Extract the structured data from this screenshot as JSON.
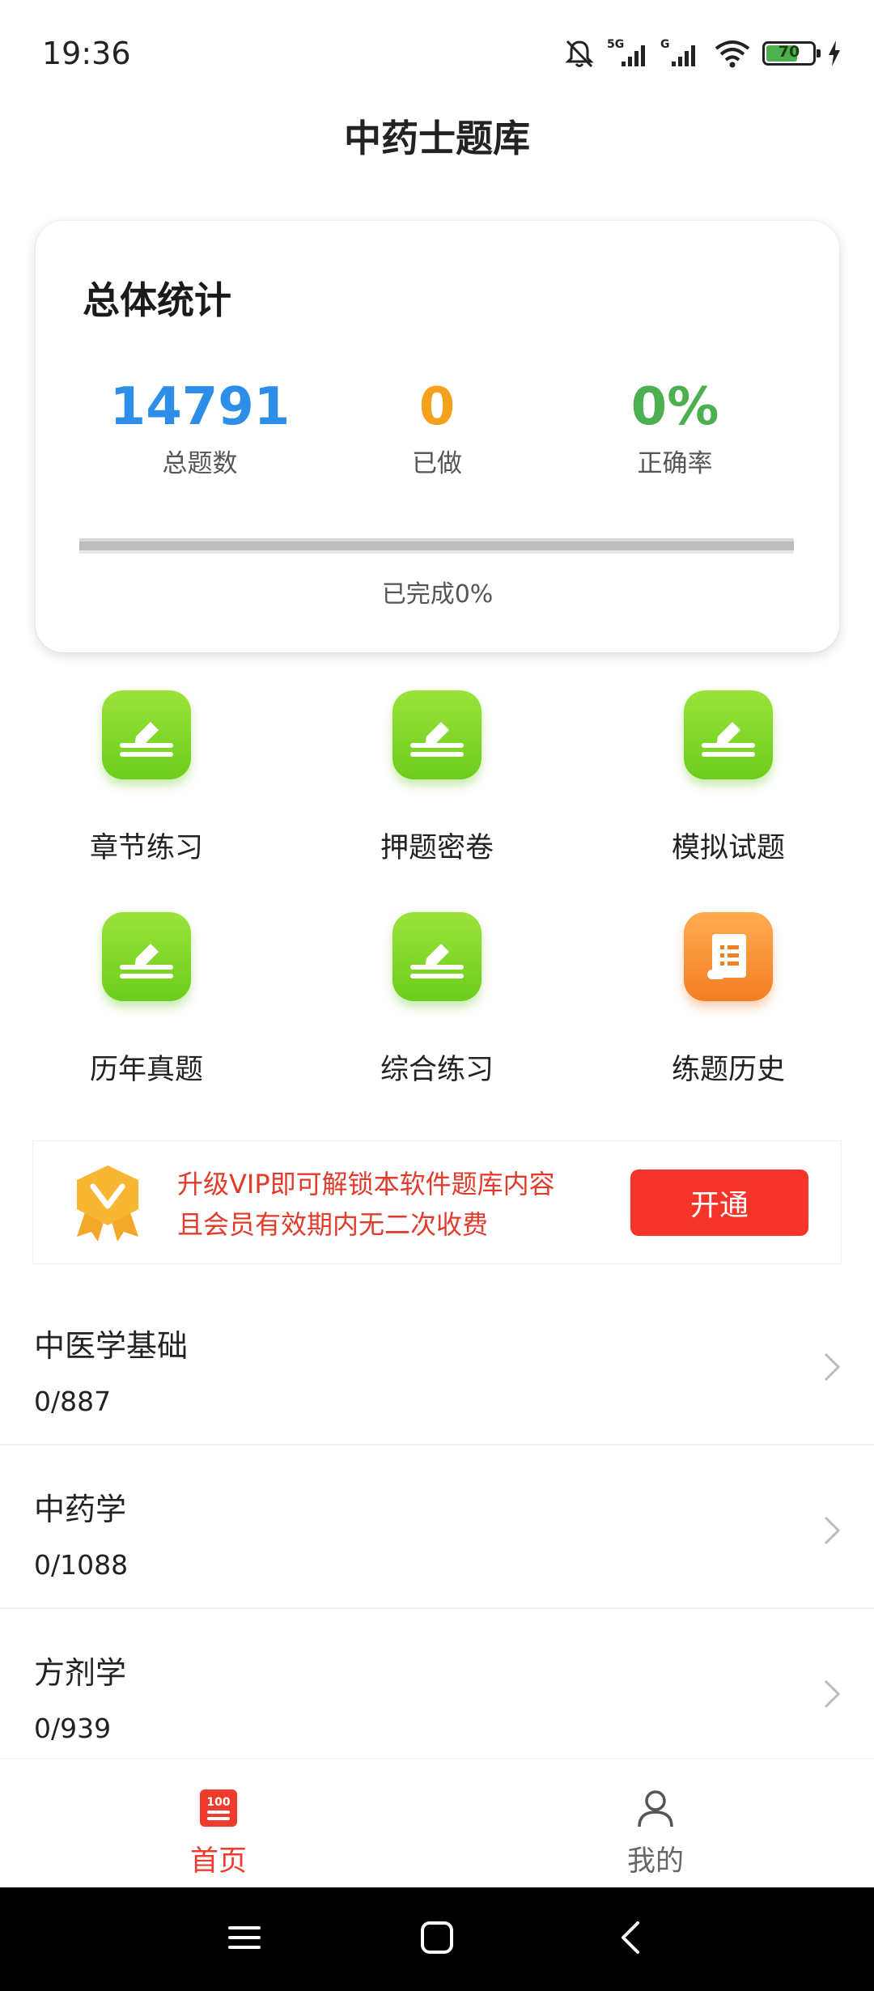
{
  "status_bar": {
    "time": "19:36",
    "battery_level": "70",
    "battery_fraction": 0.7,
    "icons": [
      "bell-muted-icon",
      "signal-5g-icon",
      "signal-g-icon",
      "wifi-icon",
      "battery-icon",
      "charging-icon"
    ]
  },
  "header": {
    "title": "中药士题库"
  },
  "stats": {
    "title": "总体统计",
    "total_value": "14791",
    "total_label": "总题数",
    "done_value": "0",
    "done_label": "已做",
    "accuracy_value": "0%",
    "accuracy_label": "正确率",
    "progress_fraction": 0.0,
    "progress_text": "已完成0%",
    "colors": {
      "total": "#2c8ee8",
      "done": "#f5a11c",
      "accuracy": "#4caf50"
    }
  },
  "grid": [
    {
      "label": "章节练习",
      "icon": "pen-edit-icon",
      "color": "#7fd629"
    },
    {
      "label": "押题密卷",
      "icon": "pen-edit-icon",
      "color": "#7fd629"
    },
    {
      "label": "模拟试题",
      "icon": "pen-edit-icon",
      "color": "#7fd629"
    },
    {
      "label": "历年真题",
      "icon": "pen-edit-icon",
      "color": "#7fd629"
    },
    {
      "label": "综合练习",
      "icon": "pen-edit-icon",
      "color": "#7fd629"
    },
    {
      "label": "练题历史",
      "icon": "scroll-icon",
      "color": "#f68a2f"
    }
  ],
  "vip": {
    "line1": "升级VIP即可解锁本软件题库内容",
    "line2": "且会员有效期内无二次收费",
    "button": "开通",
    "badge_icon": "vip-badge-icon",
    "color": "#f5352a"
  },
  "subjects": [
    {
      "title": "中医学基础",
      "count": "0/887"
    },
    {
      "title": "中药学",
      "count": "0/1088"
    },
    {
      "title": "方剂学",
      "count": "0/939"
    }
  ],
  "tabs": [
    {
      "label": "首页",
      "icon": "home-100-icon",
      "active": true
    },
    {
      "label": "我的",
      "icon": "person-icon",
      "active": false
    }
  ],
  "accent_color": "#ee3b2e"
}
